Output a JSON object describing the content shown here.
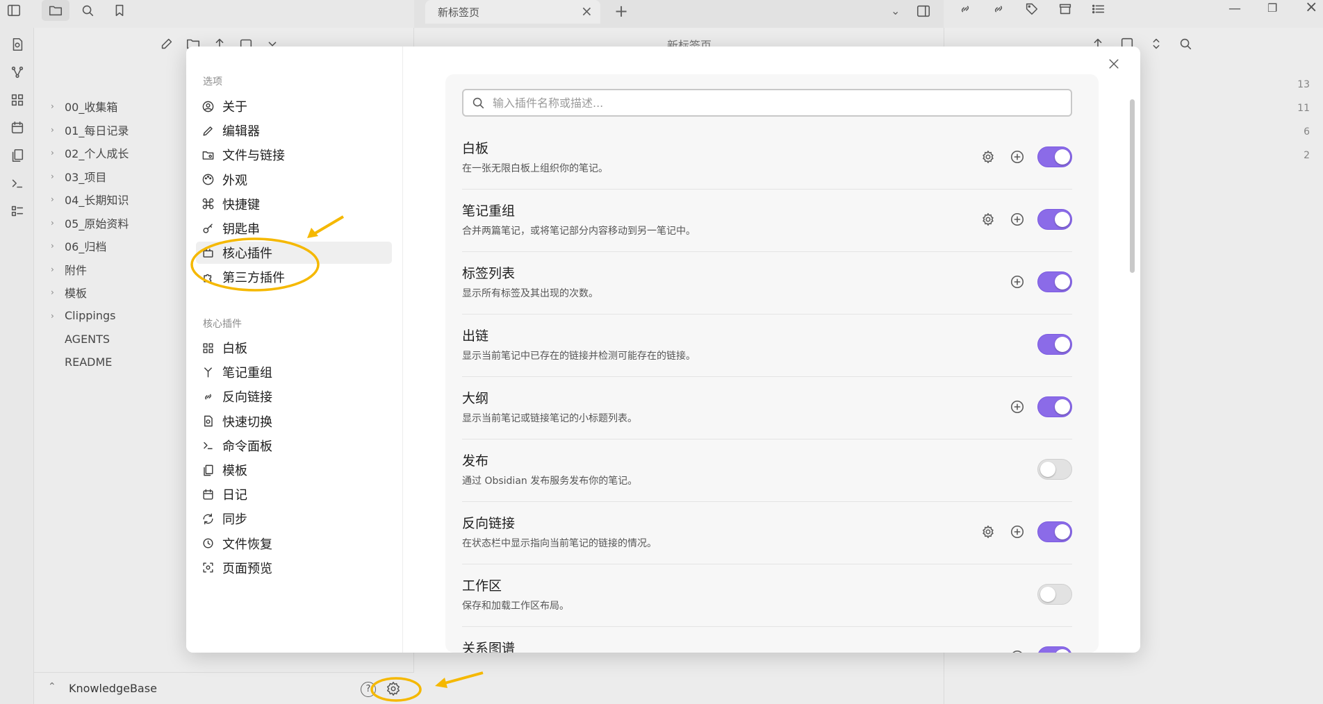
{
  "tab": {
    "title": "新标签页",
    "header": "新标签页"
  },
  "file_tree": {
    "items": [
      {
        "label": "00_收集箱",
        "folder": true
      },
      {
        "label": "01_每日记录",
        "folder": true
      },
      {
        "label": "02_个人成长",
        "folder": true
      },
      {
        "label": "03_项目",
        "folder": true
      },
      {
        "label": "04_长期知识",
        "folder": true
      },
      {
        "label": "05_原始资料",
        "folder": true
      },
      {
        "label": "06_归档",
        "folder": true
      },
      {
        "label": "附件",
        "folder": true
      },
      {
        "label": "模板",
        "folder": true
      },
      {
        "label": "Clippings",
        "folder": true
      },
      {
        "label": "AGENTS",
        "folder": false
      },
      {
        "label": "README",
        "folder": false
      }
    ]
  },
  "vault": {
    "name": "KnowledgeBase"
  },
  "right_pane": {
    "counts": [
      "13",
      "11",
      "6",
      "2"
    ]
  },
  "settings": {
    "options_heading": "选项",
    "options": [
      {
        "label": "关于",
        "icon": "user-circle-icon"
      },
      {
        "label": "编辑器",
        "icon": "pencil-icon"
      },
      {
        "label": "文件与链接",
        "icon": "folder-cog-icon"
      },
      {
        "label": "外观",
        "icon": "palette-icon"
      },
      {
        "label": "快捷键",
        "icon": "command-icon"
      },
      {
        "label": "钥匙串",
        "icon": "key-icon"
      },
      {
        "label": "核心插件",
        "icon": "plug-box-icon"
      },
      {
        "label": "第三方插件",
        "icon": "puzzle-icon"
      }
    ],
    "core_heading": "核心插件",
    "core_items": [
      {
        "label": "白板",
        "icon": "grid-icon"
      },
      {
        "label": "笔记重组",
        "icon": "merge-icon"
      },
      {
        "label": "反向链接",
        "icon": "link-icon"
      },
      {
        "label": "快速切换",
        "icon": "file-search-icon"
      },
      {
        "label": "命令面板",
        "icon": "terminal-icon"
      },
      {
        "label": "模板",
        "icon": "files-icon"
      },
      {
        "label": "日记",
        "icon": "calendar-icon"
      },
      {
        "label": "同步",
        "icon": "refresh-icon"
      },
      {
        "label": "文件恢复",
        "icon": "history-icon"
      },
      {
        "label": "页面预览",
        "icon": "scan-eye-icon"
      }
    ]
  },
  "search": {
    "placeholder": "输入插件名称或描述..."
  },
  "plugins": [
    {
      "name": "白板",
      "desc": "在一张无限白板上组织你的笔记。",
      "gear": true,
      "add": true,
      "on": true
    },
    {
      "name": "笔记重组",
      "desc": "合并两篇笔记，或将笔记部分内容移动到另一笔记中。",
      "gear": true,
      "add": true,
      "on": true
    },
    {
      "name": "标签列表",
      "desc": "显示所有标签及其出现的次数。",
      "gear": false,
      "add": true,
      "on": true
    },
    {
      "name": "出链",
      "desc": "显示当前笔记中已存在的链接并检测可能存在的链接。",
      "gear": false,
      "add": false,
      "on": true
    },
    {
      "name": "大纲",
      "desc": "显示当前笔记或链接笔记的小标题列表。",
      "gear": false,
      "add": true,
      "on": true
    },
    {
      "name": "发布",
      "desc": "通过 Obsidian 发布服务发布你的笔记。",
      "gear": false,
      "add": false,
      "on": false
    },
    {
      "name": "反向链接",
      "desc": "在状态栏中显示指向当前笔记的链接的情况。",
      "gear": true,
      "add": true,
      "on": true
    },
    {
      "name": "工作区",
      "desc": "保存和加载工作区布局。",
      "gear": false,
      "add": false,
      "on": false
    },
    {
      "name": "关系图谱",
      "desc": "",
      "gear": false,
      "add": true,
      "on": true
    }
  ],
  "colors": {
    "accent": "#8b6be8",
    "annotation": "#f5b800"
  }
}
